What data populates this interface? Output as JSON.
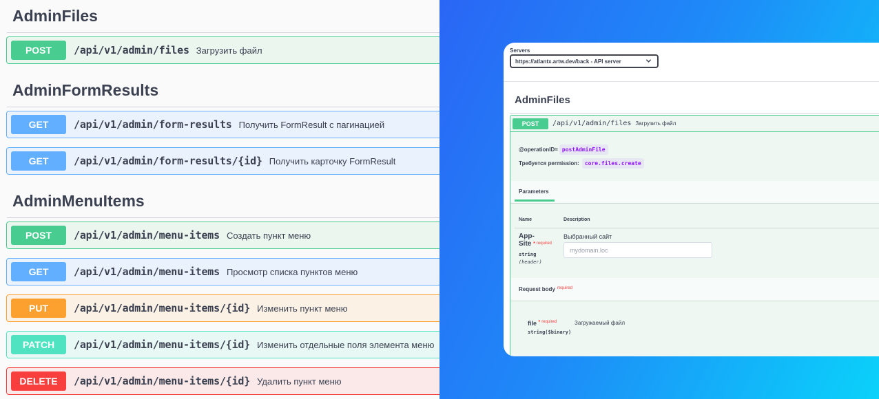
{
  "left_panel": {
    "sections": [
      {
        "title": "AdminFiles",
        "ops": [
          {
            "method": "POST",
            "path": "/api/v1/admin/files",
            "summary": "Загрузить файл"
          }
        ]
      },
      {
        "title": "AdminFormResults",
        "ops": [
          {
            "method": "GET",
            "path": "/api/v1/admin/form-results",
            "summary": "Получить FormResult с пагинацией"
          },
          {
            "method": "GET",
            "path": "/api/v1/admin/form-results/{id}",
            "summary": "Получить карточку FormResult"
          }
        ]
      },
      {
        "title": "AdminMenuItems",
        "ops": [
          {
            "method": "POST",
            "path": "/api/v1/admin/menu-items",
            "summary": "Создать пункт меню"
          },
          {
            "method": "GET",
            "path": "/api/v1/admin/menu-items",
            "summary": "Просмотр списка пунктов меню"
          },
          {
            "method": "PUT",
            "path": "/api/v1/admin/menu-items/{id}",
            "summary": "Изменить пункт меню"
          },
          {
            "method": "PATCH",
            "path": "/api/v1/admin/menu-items/{id}",
            "summary": "Изменить отдельные поля элемента меню"
          },
          {
            "method": "DELETE",
            "path": "/api/v1/admin/menu-items/{id}",
            "summary": "Удалить пункт меню"
          }
        ]
      }
    ]
  },
  "right_panel": {
    "servers_label": "Servers",
    "server_selected": "https://atlantx.artw.dev/back - API server",
    "server_chevron_icon": "chevron-down-icon",
    "tag_title": "AdminFiles",
    "operation": {
      "method": "POST",
      "path": "/api/v1/admin/files",
      "summary": "Загрузить файл",
      "operation_id_label": "@operationID=",
      "operation_id": "postAdminFile",
      "permission_label": "Требуется permission:",
      "permission": "core.files.create"
    },
    "parameters": {
      "tab_label": "Parameters",
      "col_name": "Name",
      "col_description": "Description",
      "param": {
        "name_line1": "App-",
        "name_line2": "Site",
        "required_star": "*",
        "required_word": "required",
        "type": "string",
        "location": "(header)",
        "description": "Выбранный сайт",
        "placeholder": "mydomain.loc"
      }
    },
    "request_body": {
      "title": "Request body",
      "required_word": "required",
      "field_name": "file",
      "field_required_star": "*",
      "field_required_word": "required",
      "field_type": "string($binary)",
      "field_description": "Загружаемый файл"
    }
  },
  "colors": {
    "post": "#49cc90",
    "get": "#61affe",
    "put": "#fca130",
    "patch": "#50e3c2",
    "delete": "#f93e3e",
    "text": "#3b4151",
    "code_text": "#9012fe"
  }
}
